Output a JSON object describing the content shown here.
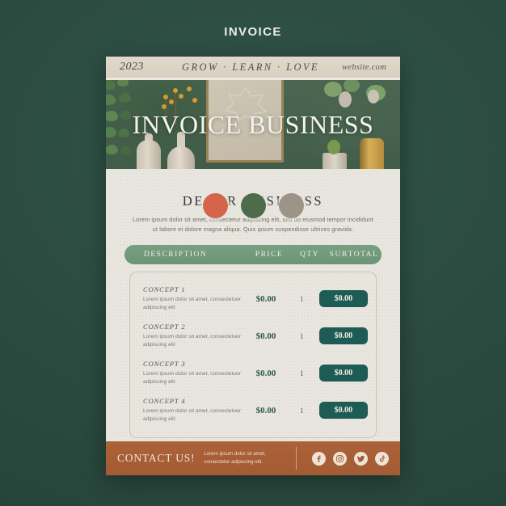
{
  "page": {
    "top_title": "INVOICE",
    "background_color": "#2d4f43"
  },
  "banner": {
    "year": "2023",
    "slogan": "GROW · LEARN · LOVE",
    "website": "website.com"
  },
  "hero": {
    "title": "INVOICE BUSINESS"
  },
  "swatches": [
    {
      "name": "terracotta",
      "color": "#d4654a"
    },
    {
      "name": "forest-green",
      "color": "#4e6b4c"
    },
    {
      "name": "warm-grey",
      "color": "#9d9488"
    }
  ],
  "body": {
    "title": "DECOR BUSINESS",
    "description": "Lorem ipsum dolor sit amet, consectetur adipiscing elit, sed do eiusmod tempor incididunt ut labore et dolore magna aliqua. Quis ipsum suspendisse ultrices gravida."
  },
  "table": {
    "headers": {
      "description": "DESCRIPTION",
      "price": "PRICE",
      "qty": "QTY",
      "subtotal": "SUBTOTAL"
    },
    "rows": [
      {
        "concept": "CONCEPT 1",
        "description": "Lorem ipsum dolor sit amet, consectetuer adipiscing elit",
        "price": "$0.00",
        "qty": "1",
        "subtotal": "$0.00"
      },
      {
        "concept": "CONCEPT 2",
        "description": "Lorem ipsum dolor sit amet, consectetuer adipiscing elit",
        "price": "$0.00",
        "qty": "1",
        "subtotal": "$0.00"
      },
      {
        "concept": "CONCEPT 3",
        "description": "Lorem ipsum dolor sit amet, consectetuer adipiscing elit",
        "price": "$0.00",
        "qty": "1",
        "subtotal": "$0.00"
      },
      {
        "concept": "CONCEPT 4",
        "description": "Lorem ipsum dolor sit amet, consectetuer adipiscing elit",
        "price": "$0.00",
        "qty": "1",
        "subtotal": "$0.00"
      }
    ]
  },
  "footer": {
    "title": "CONTACT US!",
    "description": "Lorem ipsum dolor sit amet, consectetur adipiscing elit.",
    "background_color": "#ac6239",
    "socials": [
      {
        "name": "facebook-icon"
      },
      {
        "name": "instagram-icon"
      },
      {
        "name": "twitter-icon"
      },
      {
        "name": "tiktok-icon"
      }
    ]
  },
  "colors": {
    "table_header_green": "#6b9577",
    "subtotal_teal": "#1d5b55",
    "paper": "#e8e6df",
    "banner_beige": "#d9d0c1"
  }
}
